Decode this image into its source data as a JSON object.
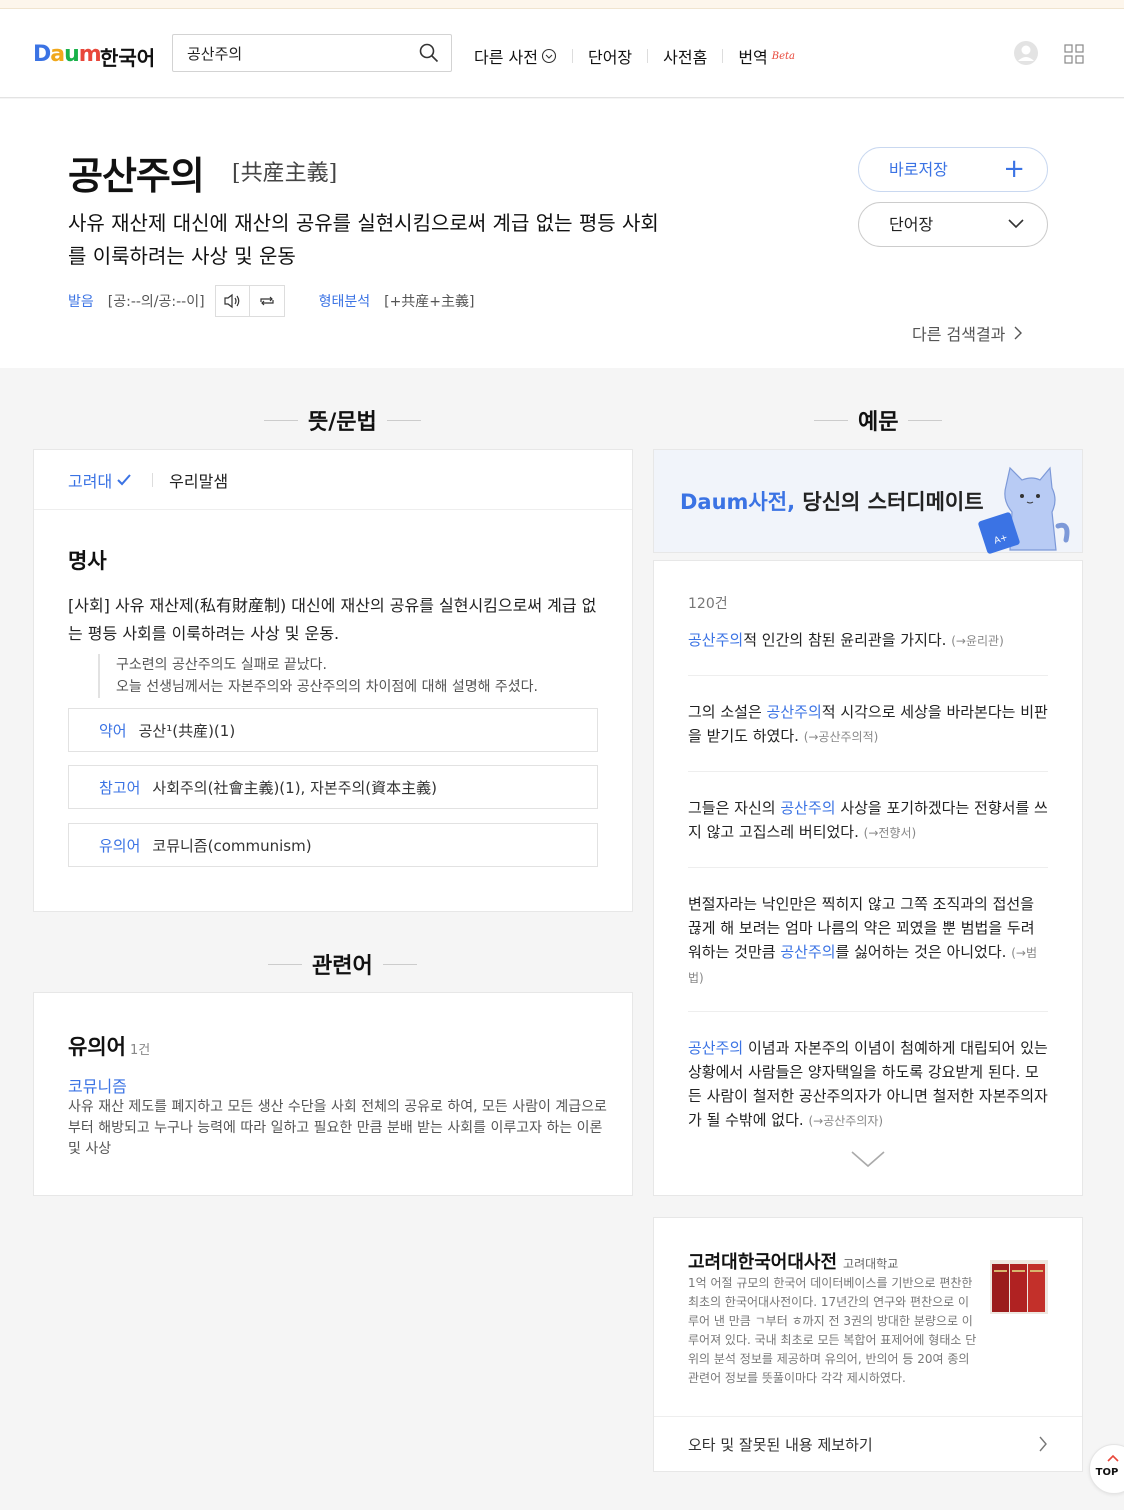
{
  "header": {
    "logo": {
      "d": "D",
      "a": "a",
      "u": "u",
      "m": "m",
      "lang": "한국어"
    },
    "search": {
      "value": "공산주의",
      "placeholder": ""
    },
    "nav": [
      {
        "label": "다른 사전"
      },
      {
        "label": "단어장"
      },
      {
        "label": "사전홈"
      },
      {
        "label": "번역",
        "badge": "Beta"
      }
    ]
  },
  "entry": {
    "word": "공산주의",
    "hanja": "[共産主義]",
    "summary": "사유 재산제 대신에 재산의 공유를 실현시킴으로써 계급 없는 평등 사회를 이룩하려는 사상 및 운동",
    "pron_label": "발음",
    "pron_value": "[공:--의/공:--이]",
    "morph_label": "형태분석",
    "morph_value": "[+共産+主義]",
    "save_label": "바로저장",
    "wordbook_label": "단어장",
    "other_results": "다른 검색결과"
  },
  "meaning": {
    "section_title": "뜻/문법",
    "tabs": [
      "고려대",
      "우리말샘"
    ],
    "pos": "명사",
    "definition": "[사회] 사유 재산제(私有財産制) 대신에 재산의 공유를 실현시킴으로써 계급 없는 평등 사회를 이룩하려는 사상 및 운동.",
    "examples": [
      "구소련의 공산주의도 실패로 끝났다.",
      "오늘 선생님께서는 자본주의와 공산주의의 차이점에 대해 설명해 주셨다."
    ],
    "relations": [
      {
        "key": "약어",
        "value": "공산¹(共産)(1)"
      },
      {
        "key": "참고어",
        "value": "사회주의(社會主義)(1), 자본주의(資本主義)"
      },
      {
        "key": "유의어",
        "value": "코뮤니즘(communism)"
      }
    ]
  },
  "related": {
    "section_title": "관련어",
    "heading": "유의어",
    "count": "1건",
    "word": "코뮤니즘",
    "description": "사유 재산 제도를 폐지하고 모든 생산 수단을 사회 전체의 공유로 하여, 모든 사람이 계급으로부터 해방되고 누구나 능력에 따라 일하고 필요한 만큼 분배 받는 사회를 이루고자 하는 이론 및 사상"
  },
  "examples": {
    "section_title": "예문",
    "banner_brand": "Daum사전,",
    "banner_text": "당신의 스터디메이트",
    "count": "120건",
    "items": [
      {
        "before": "",
        "hl": "공산주의",
        "after": "적 인간의 참된 윤리관을 가지다.",
        "src": "(→윤리관)"
      },
      {
        "before": "그의 소설은 ",
        "hl": "공산주의",
        "after": "적 시각으로 세상을 바라본다는 비판을 받기도 하였다.",
        "src": "(→공산주의적)"
      },
      {
        "before": "그들은 자신의 ",
        "hl": "공산주의",
        "after": " 사상을 포기하겠다는 전향서를 쓰지 않고 고집스레 버티었다.",
        "src": "(→전향서)"
      },
      {
        "before": "변절자라는 낙인만은 찍히지 않고 그쪽 조직과의 접선을 끊게 해 보려는 엄마 나름의 약은 꾀였을 뿐 범법을 두려워하는 것만큼 ",
        "hl": "공산주의",
        "after": "를 싫어하는 것은 아니었다.",
        "src": "(→범법)"
      },
      {
        "before": "",
        "hl": "공산주의",
        "after": " 이념과 자본주의 이념이 첨예하게 대립되어 있는 상황에서 사람들은 양자택일을 하도록 강요받게 된다. 모든 사람이 철저한 공산주의자가 아니면 철저한 자본주의자가 될 수밖에 없다.",
        "src": "(→공산주의자)"
      }
    ]
  },
  "dictionary": {
    "title": "고려대한국어대사전",
    "publisher": "고려대학교",
    "description": "1억 어절 규모의 한국어 데이터베이스를 기반으로 편찬한 최초의 한국어대사전이다. 17년간의 연구와 편찬으로 이루어 낸 만큼 ㄱ부터 ㅎ까지 전 3권의 방대한 분량으로 이루어져 있다. 국내 최초로 모든 복합어 표제어에 형태소 단위의 분석 정보를 제공하며 유의어, 반의어 등 20여 종의 관련어 정보를 뜻풀이마다 각각 제시하였다.",
    "report": "오타 및 잘못된 내용 제보하기"
  },
  "top_button": "TOP",
  "colors": {
    "accent": "#3b73e4",
    "background": "#f5f5f5"
  }
}
